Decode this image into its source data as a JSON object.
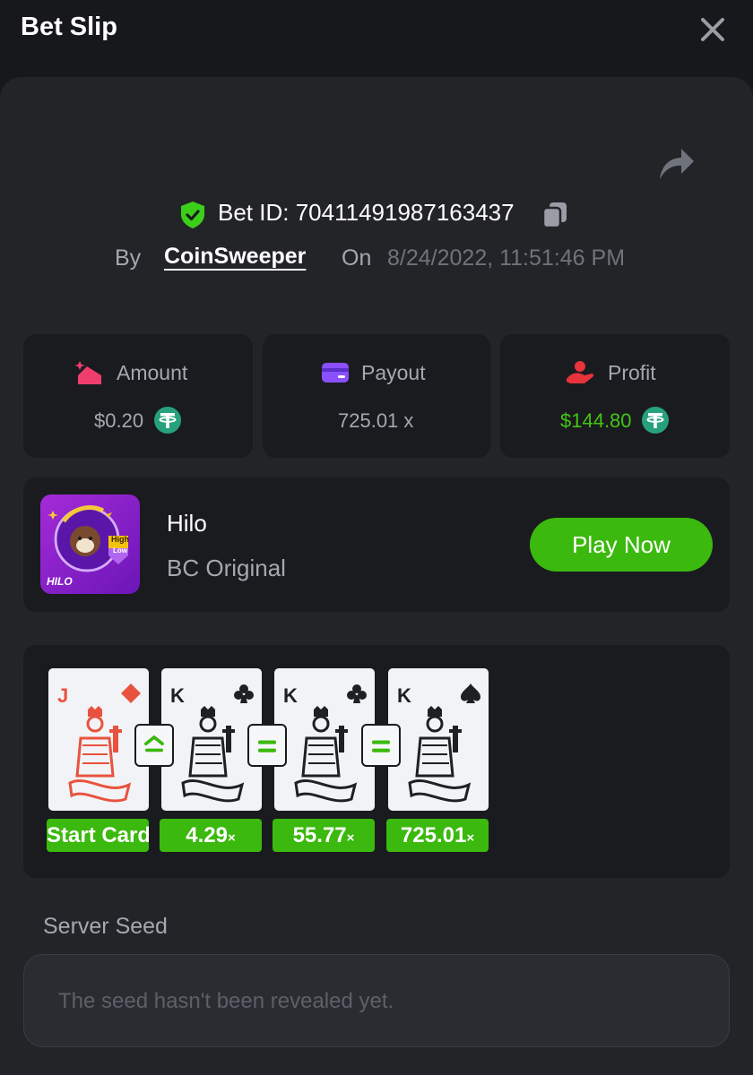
{
  "header": {
    "title": "Bet Slip"
  },
  "bet": {
    "id_text": "Bet ID: 70411491987163437",
    "by_label": "By",
    "username": "CoinSweeper",
    "on_label": "On",
    "datetime": "8/24/2022, 11:51:46 PM"
  },
  "stats": {
    "amount": {
      "label": "Amount",
      "value": "$0.20"
    },
    "payout": {
      "label": "Payout",
      "value": "725.01 x"
    },
    "profit": {
      "label": "Profit",
      "value": "$144.80"
    }
  },
  "game": {
    "name": "Hilo",
    "category": "BC Original",
    "play_label": "Play Now",
    "thumb_text": "HILO",
    "thumb_high": "High",
    "thumb_low": "Low"
  },
  "rounds": [
    {
      "rank": "J",
      "suit": "diamond-icon",
      "color": "#e8533f",
      "multiplier": "Start Card",
      "suffix": ""
    },
    {
      "rank": "K",
      "suit": "club-icon",
      "color": "#1f2024",
      "multiplier": "4.29",
      "suffix": "×"
    },
    {
      "rank": "K",
      "suit": "club-icon",
      "color": "#1f2024",
      "multiplier": "55.77",
      "suffix": "×"
    },
    {
      "rank": "K",
      "suit": "spade-icon",
      "color": "#1f2024",
      "multiplier": "725.01",
      "suffix": "×"
    }
  ],
  "guesses": [
    "higher-or-same-icon",
    "equal-icon",
    "equal-icon"
  ],
  "seed": {
    "label": "Server Seed",
    "placeholder": "The seed hasn't been revealed yet."
  },
  "colors": {
    "accent_green": "#3bb90e",
    "profit_green": "#43c415",
    "tether": "#26a17b"
  }
}
